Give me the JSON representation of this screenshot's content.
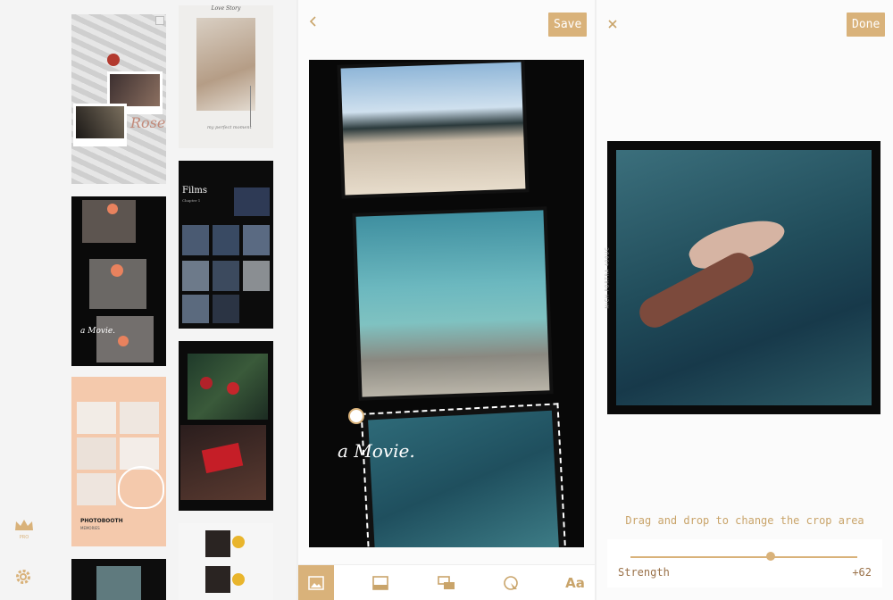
{
  "left_panel": {
    "templates": [
      {
        "title": "Rose"
      },
      {
        "title": "Love Story",
        "caption": "my perfect moment"
      },
      {
        "title": "a Movie."
      },
      {
        "title": "Films",
        "subtitle": "Chapter 1"
      },
      {
        "title": "PHOTOBOOTH",
        "subtitle": "MEMORIES"
      }
    ],
    "pro_label": "PRO"
  },
  "editor": {
    "save_label": "Save",
    "overlay_text": "a Movie.",
    "tabs": [
      "image-icon",
      "frame-icon",
      "layout-icon",
      "filter-icon",
      "text-icon"
    ],
    "text_tab_label": "Aa"
  },
  "crop": {
    "done_label": "Done",
    "hint": "Drag and drop to change the crop area",
    "strength_label": "Strength",
    "strength_value": "+62",
    "strength_fraction": 0.62,
    "film_label": "NICH PORTRA 400UC"
  },
  "colors": {
    "accent": "#d9b27a",
    "text_gold": "#c9a46a"
  }
}
